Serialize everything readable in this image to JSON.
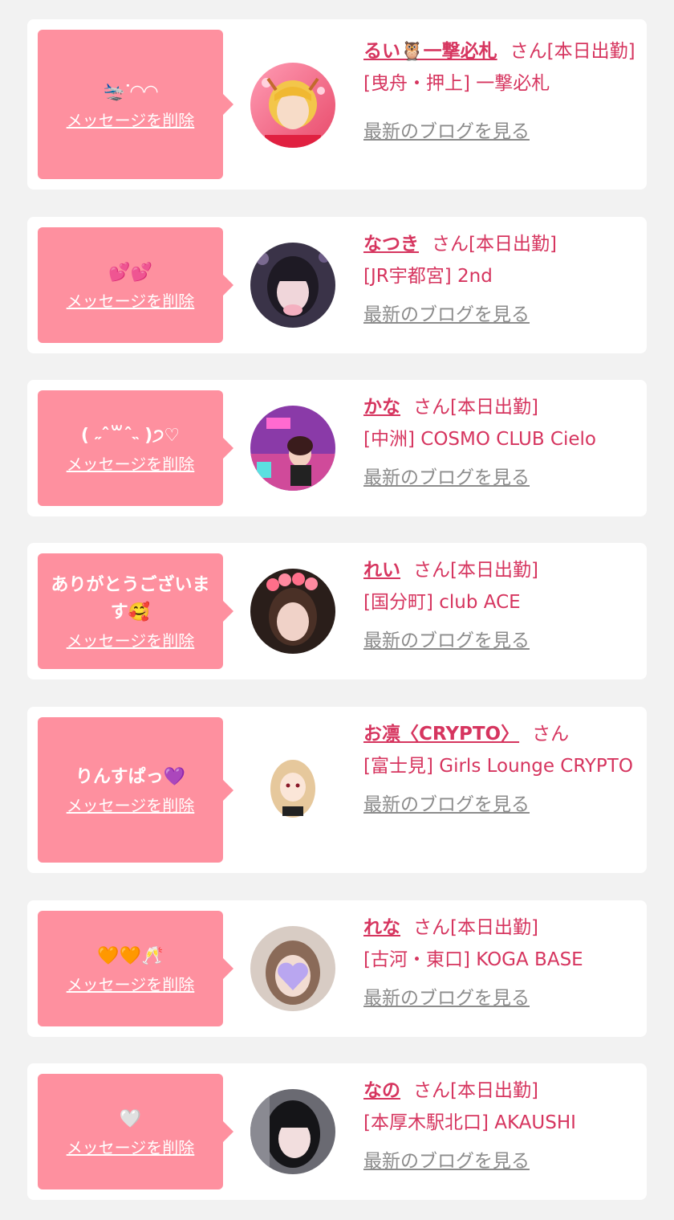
{
  "delete_label": "メッセージを削除",
  "blog_label": "最新のブログを見る",
  "honorific": "さん",
  "colors": {
    "background": "#f2f2f2",
    "card": "#ffffff",
    "bubble": "#fe909f",
    "accent_text": "#d6355f",
    "link_gray": "#8c8c8c"
  },
  "messages": [
    {
      "message": "🛬ᐝ◠◠",
      "name": "るい🦉一撃必札",
      "status": "[本日出勤]",
      "shop": "[曳舟・押上] 一撃必札",
      "avatar_icon": "blonde-girl-photo"
    },
    {
      "message": "💕💕",
      "name": "なつき",
      "status": "[本日出勤]",
      "shop": "[JR宇都宮] 2nd",
      "avatar_icon": "girl-photo-bangs"
    },
    {
      "message": "( ˶ˆ꒳ˆ˵ )੭♡",
      "name": "かな",
      "status": "[本日出勤]",
      "shop": "[中洲] COSMO CLUB Cielo",
      "avatar_icon": "girl-photo-purple-room"
    },
    {
      "message": "ありがとうございます🥰",
      "name": "れい",
      "status": "[本日出勤]",
      "shop": "[国分町] club ACE",
      "avatar_icon": "girl-photo-flower-crown"
    },
    {
      "message": "りんすぱっ💜",
      "name": "お凛〈CRYPTO〉",
      "status": "",
      "shop": "[富士見] Girls Lounge CRYPTO",
      "avatar_icon": "anime-girl-illustration"
    },
    {
      "message": "🧡🧡🥂",
      "name": "れな",
      "status": "[本日出勤]",
      "shop": "[古河・東口] KOGA BASE",
      "avatar_icon": "girl-photo-heart-blur"
    },
    {
      "message": "🤍",
      "name": "なの",
      "status": "[本日出勤]",
      "shop": "[本厚木駅北口] AKAUSHI",
      "avatar_icon": "girl-photo-dark-hair"
    }
  ]
}
